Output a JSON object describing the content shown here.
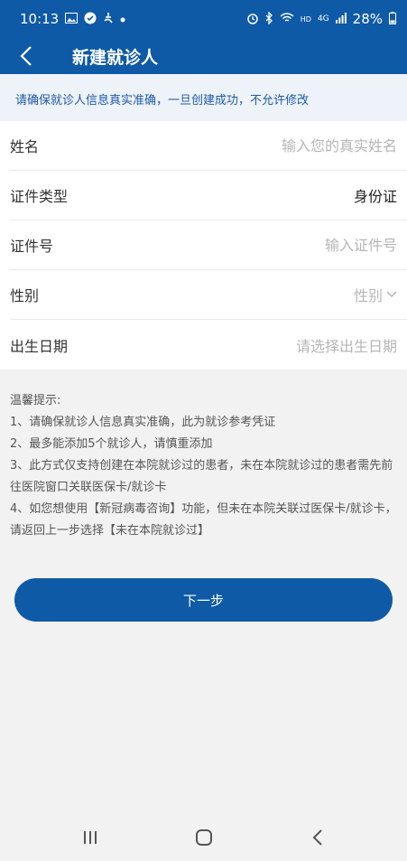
{
  "status_bar": {
    "time": "10:13",
    "network_hd": "HD",
    "network_gen": "4G",
    "battery": "28%"
  },
  "header": {
    "title": "新建就诊人"
  },
  "notice": "请确保就诊人信息真实准确，一旦创建成功，不允许修改",
  "form": {
    "name": {
      "label": "姓名",
      "placeholder": "输入您的真实姓名"
    },
    "id_type": {
      "label": "证件类型",
      "value": "身份证"
    },
    "id_number": {
      "label": "证件号",
      "placeholder": "输入证件号"
    },
    "gender": {
      "label": "性别",
      "placeholder": "性别"
    },
    "birthdate": {
      "label": "出生日期",
      "placeholder": "请选择出生日期"
    }
  },
  "tips": {
    "title": "温馨提示:",
    "items": [
      "1、请确保就诊人信息真实准确，此为就诊参考凭证",
      "2、最多能添加5个就诊人，请慎重添加",
      "3、此方式仅支持创建在本院就诊过的患者，未在本院就诊过的患者需先前往医院窗口关联医保卡/就诊卡",
      "4、如您想使用【新冠病毒咨询】功能，但未在本院关联过医保卡/就诊卡，请返回上一步选择【未在本院就诊过】"
    ]
  },
  "next_button": "下一步",
  "colors": {
    "primary": "#0f5aa6",
    "notice_bg": "#eef3fa",
    "notice_text": "#1d58a8",
    "page_bg": "#f2f2f2"
  }
}
